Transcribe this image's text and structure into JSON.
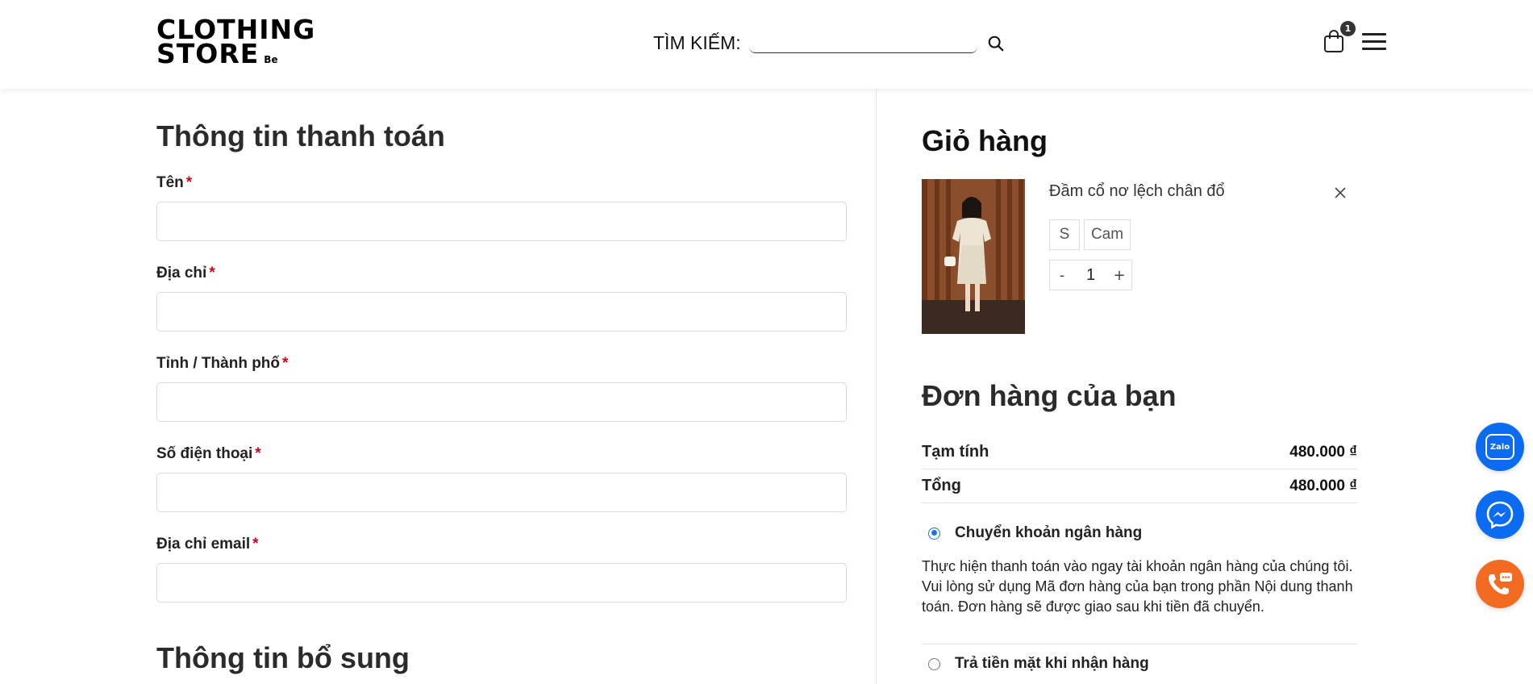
{
  "header": {
    "logo_line1": "CLOTHING",
    "logo_line2": "STORE",
    "logo_sub": "Be",
    "search_label": "TÌM KIẾM:",
    "search_placeholder": "",
    "cart_count": "1",
    "icons": [
      "search-icon",
      "shopping-bag-icon",
      "hamburger-menu-icon"
    ]
  },
  "billing": {
    "title": "Thông tin thanh toán",
    "required_mark": "*",
    "fields": [
      {
        "label": "Tên",
        "value": ""
      },
      {
        "label": "Địa chỉ",
        "value": ""
      },
      {
        "label": "Tỉnh / Thành phố",
        "value": ""
      },
      {
        "label": "Số điện thoại",
        "value": ""
      },
      {
        "label": "Địa chỉ email",
        "value": ""
      }
    ]
  },
  "additional": {
    "title": "Thông tin bổ sung"
  },
  "cart": {
    "title": "Giỏ hàng",
    "items": [
      {
        "name": "Đầm cổ nơ lệch chân đổ",
        "size": "S",
        "color": "Cam",
        "qty_minus": "-",
        "qty": "1",
        "qty_plus": "+"
      }
    ]
  },
  "order": {
    "title": "Đơn hàng của bạn",
    "subtotal_label": "Tạm tính",
    "subtotal_value": "480.000 ₫",
    "total_label": "Tổng",
    "total_value": "480.000 ₫",
    "payment_methods": [
      {
        "label": "Chuyển khoản ngân hàng",
        "selected": true,
        "description": "Thực hiện thanh toán vào ngay tài khoản ngân hàng của chúng tôi. Vui lòng sử dụng Mã đơn hàng của bạn trong phần Nội dung thanh toán. Đơn hàng sẽ được giao sau khi tiền đã chuyển."
      },
      {
        "label": "Trả tiền mặt khi nhận hàng",
        "selected": false
      }
    ]
  },
  "floating": {
    "zalo_text": "Zalo",
    "icons": [
      "zalo-icon",
      "messenger-icon",
      "phone-icon"
    ]
  },
  "colors": {
    "accent": "#0b6cf2",
    "phone": "#f26b21",
    "required": "#d0021b",
    "radio": "#1a73e8"
  }
}
